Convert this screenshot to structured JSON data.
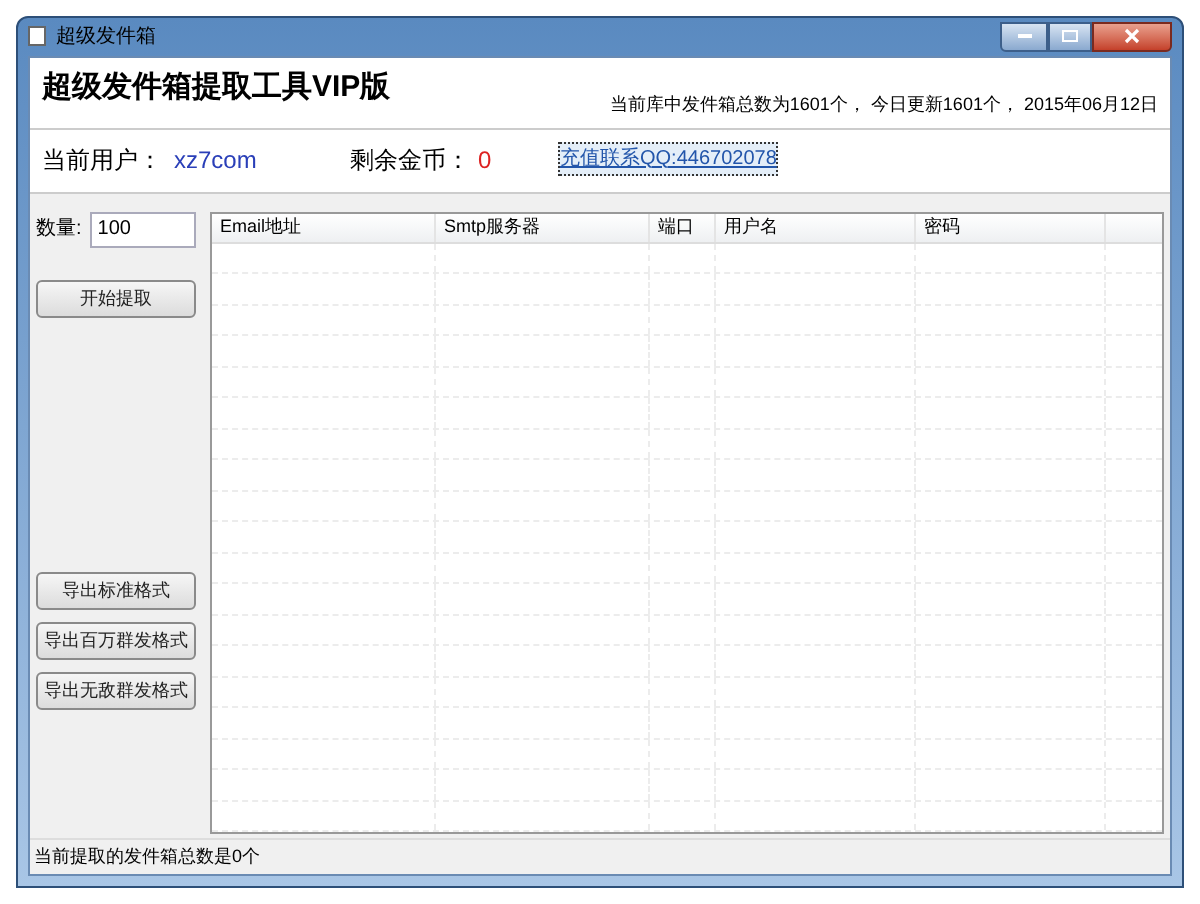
{
  "window": {
    "title": "超级发件箱"
  },
  "header": {
    "title": "超级发件箱提取工具VIP版",
    "stats": "当前库中发件箱总数为1601个，  今日更新1601个，  2015年06月12日"
  },
  "user_row": {
    "user_label": "当前用户：",
    "user_value": "xz7com",
    "coins_label": "剩余金币：",
    "coins_value": "0",
    "link": "充值联系QQ:446702078"
  },
  "sidebar": {
    "quantity_label": "数量:",
    "quantity_value": "100",
    "start_button": "开始提取",
    "export_buttons": [
      "导出标准格式",
      "导出百万群发格式",
      "导出无敌群发格式"
    ]
  },
  "table": {
    "columns": [
      "Email地址",
      "Smtp服务器",
      "端口",
      "用户名",
      "密码"
    ]
  },
  "status_bar": "当前提取的发件箱总数是0个"
}
